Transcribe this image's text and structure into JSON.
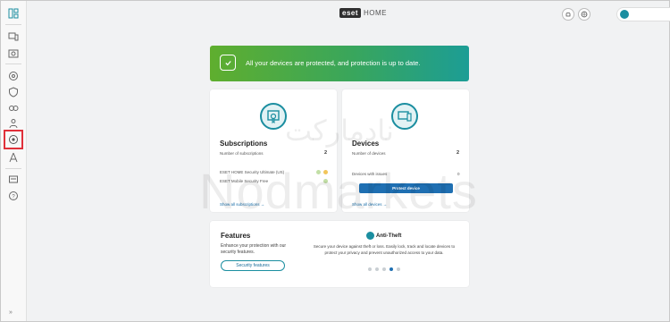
{
  "brand": {
    "logo_text": "eset",
    "suffix": "HOME"
  },
  "sidebar": {
    "icons": [
      "dashboard-icon",
      "devices-icon",
      "license-icon",
      "settings-icon",
      "shield-icon",
      "family-icon",
      "users-icon",
      "anti-theft-icon",
      "network-icon",
      "messages-icon",
      "help-icon"
    ],
    "active_item": "anti-theft-icon",
    "collapse_label": "»"
  },
  "topbar": {
    "icons": [
      "bell-icon",
      "globe-icon",
      "user-icon"
    ]
  },
  "banner": {
    "message": "All your devices are protected, and protection is up to date.",
    "color_start": "#5fae2e",
    "color_end": "#1c9d95"
  },
  "subscriptions": {
    "title": "Subscriptions",
    "count_label": "Number of subscriptions",
    "count_value": "2",
    "items": [
      "ESET HOME Security Ultimate (US)",
      "ESET Mobile Security Free"
    ],
    "link": "Show all subscriptions →"
  },
  "devices": {
    "title": "Devices",
    "count_label": "Number of devices",
    "count_value": "2",
    "issues_label": "Devices with issues",
    "issues_value": "0",
    "button": "Protect device",
    "link": "Show all devices →"
  },
  "features": {
    "title": "Features",
    "description": "Enhance your protection with our security features.",
    "button": "Security features",
    "feature_title": "Anti-Theft",
    "feature_desc": "Secure your device against theft or loss. Easily lock, track and locate devices to protect your privacy and prevent unauthorized access to your data.",
    "carousel_count": 5,
    "carousel_active": 4
  },
  "watermark": {
    "fa": "نادمارکت",
    "en": "Nodmarkets"
  },
  "colors": {
    "accent": "#1b8ea0",
    "primary_button": "#1f6fb2",
    "active_outline": "#e0303a"
  }
}
